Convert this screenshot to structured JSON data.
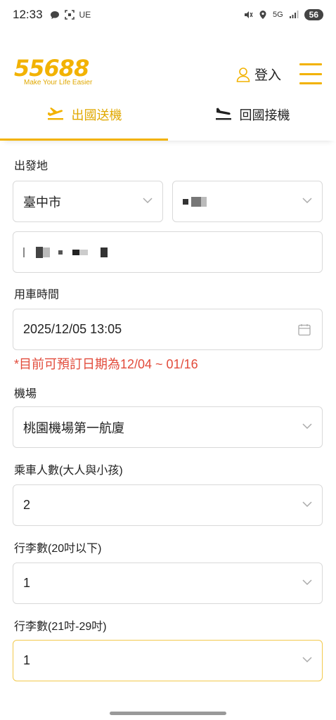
{
  "status_bar": {
    "time": "12:33",
    "carrier_tag": "UE",
    "network": "5G",
    "battery": "56"
  },
  "header": {
    "logo_text": "55688",
    "logo_tagline": "Make Your Life Easier",
    "login_label": "登入"
  },
  "tabs": [
    {
      "label": "出國送機",
      "icon": "plane-takeoff-icon",
      "active": true
    },
    {
      "label": "回國接機",
      "icon": "plane-landing-icon",
      "active": false
    }
  ],
  "form": {
    "origin_label": "出發地",
    "city_value": "臺中市",
    "district_value": "",
    "address_value": "",
    "time_label": "用車時間",
    "datetime_value": "2025/12/05 13:05",
    "booking_notice": "*目前可預訂日期為12/04 ~ 01/16",
    "airport_label": "機場",
    "airport_value": "桃園機場第一航廈",
    "passengers_label": "乘車人數(大人與小孩)",
    "passengers_value": "2",
    "luggage_small_label": "行李數(20吋以下)",
    "luggage_small_value": "1",
    "luggage_large_label": "行李數(21吋-29吋)",
    "luggage_large_value": "1"
  },
  "colors": {
    "brand": "#f2b200",
    "notice": "#e24b3b",
    "border": "#d9d9d9"
  }
}
